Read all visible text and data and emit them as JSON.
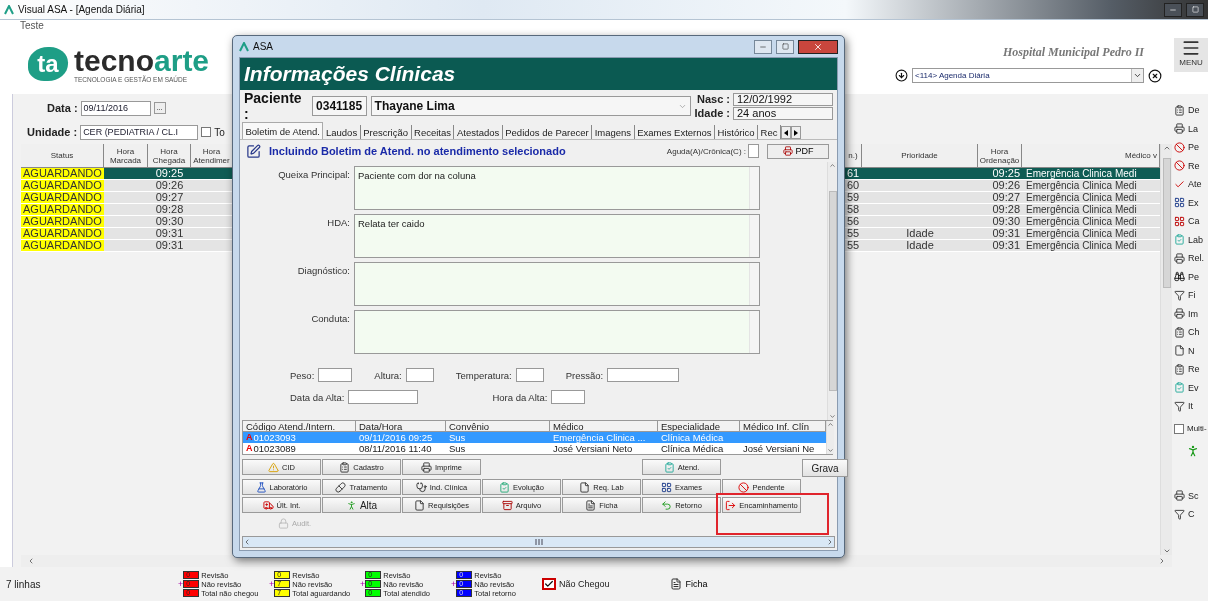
{
  "window": {
    "title": "Visual ASA - [Agenda Diária]"
  },
  "menu": [
    "Teste"
  ],
  "header": {
    "logo": {
      "mark": "ta",
      "name_start": "tecno",
      "name_end": "arte",
      "tagline": "TECNOLOGIA E GESTÃO EM SAÚDE"
    },
    "hospital": "Hospital Municipal Pedro II",
    "screen": "<114> Agenda Diária",
    "menu_button": "MENU"
  },
  "filters": {
    "date_label": "Data :",
    "date": "09/11/2016",
    "date_button": "...",
    "unit_label": "Unidade :",
    "unit": "CER (PEDIATRIA / CL.I",
    "all": {
      "label": "To",
      "checked": false
    }
  },
  "agenda": {
    "left_columns": [
      "Status",
      "Hora Marcada",
      "Hora Chegada",
      "Hora Atendimer"
    ],
    "right_columns": [
      "n.)",
      "Prioridade",
      "Hora Ordenação",
      "Médico v"
    ],
    "rows": [
      {
        "status": "AGUARDANDO",
        "arrival": "09:25",
        "minutes": "61",
        "order_time": "09:25",
        "doctor": "Emergência Clinica Medi",
        "selected": true
      },
      {
        "status": "AGUARDANDO",
        "arrival": "09:26",
        "minutes": "60",
        "order_time": "09:26",
        "doctor": "Emergência Clinica Medi",
        "selected": false
      },
      {
        "status": "AGUARDANDO",
        "arrival": "09:27",
        "minutes": "59",
        "order_time": "09:27",
        "doctor": "Emergência Clinica Medi",
        "selected": false
      },
      {
        "status": "AGUARDANDO",
        "arrival": "09:28",
        "minutes": "58",
        "order_time": "09:28",
        "doctor": "Emergência Clinica Medi",
        "selected": false
      },
      {
        "status": "AGUARDANDO",
        "arrival": "09:30",
        "minutes": "56",
        "order_time": "09:30",
        "doctor": "Emergência Clinica Medi",
        "selected": false
      },
      {
        "status": "AGUARDANDO",
        "arrival": "09:31",
        "minutes": "55",
        "priority": "Idade",
        "order_time": "09:31",
        "doctor": "Emergência Clinica Medi",
        "selected": false
      },
      {
        "status": "AGUARDANDO",
        "arrival": "09:31",
        "minutes": "55",
        "priority": "Idade",
        "order_time": "09:31",
        "doctor": "Emergência Clinica Medi",
        "selected": false
      }
    ]
  },
  "sidebar": {
    "items": [
      {
        "label": "De"
      },
      {
        "label": "La"
      },
      {
        "label": "Pe"
      },
      {
        "label": "Re"
      },
      {
        "label": "Ate"
      },
      {
        "label": "Ex"
      },
      {
        "label": "Ca"
      },
      {
        "label": "Lab"
      },
      {
        "label": "Rel."
      },
      {
        "label": "Pe"
      },
      {
        "label": "Fi"
      },
      {
        "label": "Im"
      },
      {
        "label": "Ch"
      },
      {
        "label": "N"
      },
      {
        "label": "Re"
      },
      {
        "label": "Ev"
      },
      {
        "label": "It"
      }
    ],
    "multi": {
      "label": "Multi-",
      "checked": false
    },
    "bottom_items": [
      {
        "label": "Sc"
      },
      {
        "label": "C"
      }
    ]
  },
  "status_bar": {
    "row_count": "7 linhas",
    "legend": [
      {
        "plus": "+",
        "color": "#ff0000",
        "values": [
          "0",
          "0",
          "0"
        ],
        "labels": [
          "Revisão",
          "Não revisão",
          "Total não chegou"
        ]
      },
      {
        "plus": "+",
        "color": "#ffff00",
        "values": [
          "0",
          "7",
          "7"
        ],
        "labels": [
          "Revisão",
          "Não revisão",
          "Total aguardando"
        ]
      },
      {
        "plus": "+",
        "color": "#00ff00",
        "values": [
          "0",
          "0",
          "0"
        ],
        "labels": [
          "Revisão",
          "Não revisão",
          "Total atendido"
        ]
      },
      {
        "plus": "+",
        "color": "#0000ff",
        "values": [
          "0",
          "0",
          "0"
        ],
        "labels": [
          "Revisão",
          "Não revisão",
          "Total retorno"
        ]
      }
    ],
    "not_arrived": {
      "label": "Não Chegou",
      "checked": true
    },
    "sheet_button": "Ficha"
  },
  "dialog": {
    "title": "ASA",
    "heading": "Informações Clínicas",
    "patient": {
      "label": "Paciente :",
      "id": "0341185",
      "name": "Thayane Lima"
    },
    "birth": {
      "label": "Nasc :",
      "value": "12/02/1992"
    },
    "age": {
      "label": "Idade :",
      "value": "24 anos"
    },
    "tabs": [
      {
        "label": "Boletim de Atend.",
        "selected": true
      },
      {
        "label": "Laudos",
        "selected": false
      },
      {
        "label": "Prescrição",
        "selected": false
      },
      {
        "label": "Receitas",
        "selected": false
      },
      {
        "label": "Atestados",
        "selected": false
      },
      {
        "label": "Pedidos de Parecer",
        "selected": false
      },
      {
        "label": "Imagens",
        "selected": false
      },
      {
        "label": "Exames Externos",
        "selected": false
      },
      {
        "label": "Histórico",
        "selected": false
      },
      {
        "label": "Rec",
        "selected": false
      }
    ],
    "notice": "Incluindo Boletim de Atend. no atendimento selecionado",
    "acute_label": "Aguda(A)/Crônica(C) :",
    "pdf_button": "PDF",
    "text_areas": [
      {
        "label": "Queixa Principal:",
        "value": "Paciente com dor na coluna"
      },
      {
        "label": "HDA:",
        "value": "Relata ter caido"
      },
      {
        "label": "Diagnóstico:"
      },
      {
        "label": "Conduta:"
      }
    ],
    "vitals": [
      "Peso:",
      "Altura:",
      "Temperatura:",
      "Pressão:"
    ],
    "discharge": [
      "Data da Alta:",
      "Hora da Alta:"
    ],
    "history": {
      "columns": [
        "Código Atend./Intern.",
        "Data/Hora",
        "Convênio",
        "Médico",
        "Especialidade",
        "Médico Inf. Clín"
      ],
      "rows": [
        {
          "flag": "A",
          "cells": [
            "01023093",
            "09/11/2016 09:25",
            "Sus",
            "Emergência Clinica ...",
            "Clínica Médica"
          ],
          "selected": true
        },
        {
          "flag": "A",
          "cells": [
            "01023089",
            "08/11/2016 11:40",
            "Sus",
            "José Versiani Neto",
            "Clínica Médica",
            "José Versiani Ne"
          ],
          "selected": false
        }
      ]
    },
    "top_buttons": [
      "CID",
      "Cadastro",
      "Imprime"
    ],
    "attend_button": "Atend.",
    "save_button": "Grava",
    "button_rows": [
      [
        {
          "label": "Laboratório",
          "marked": false
        },
        {
          "label": "Tratamento",
          "marked": false
        },
        {
          "label": "Ind. Clínica",
          "marked": false
        },
        {
          "label": "Evolução",
          "marked": false
        },
        {
          "label": "Req. Lab",
          "marked": false
        },
        {
          "label": "Exames",
          "marked": false
        },
        {
          "label": "Pendente",
          "marked": false
        }
      ],
      [
        {
          "label": "Últ. Int.",
          "marked": false
        },
        {
          "label": "Alta",
          "marked": false
        },
        {
          "label": "Requisições",
          "marked": false
        },
        {
          "label": "Arquivo",
          "marked": false
        },
        {
          "label": "Ficha",
          "marked": false
        },
        {
          "label": "Retorno",
          "marked": false
        },
        {
          "label": "Encaminhamento",
          "marked": true
        }
      ]
    ],
    "audit_button": {
      "label": "Audit.",
      "disabled": true
    }
  }
}
